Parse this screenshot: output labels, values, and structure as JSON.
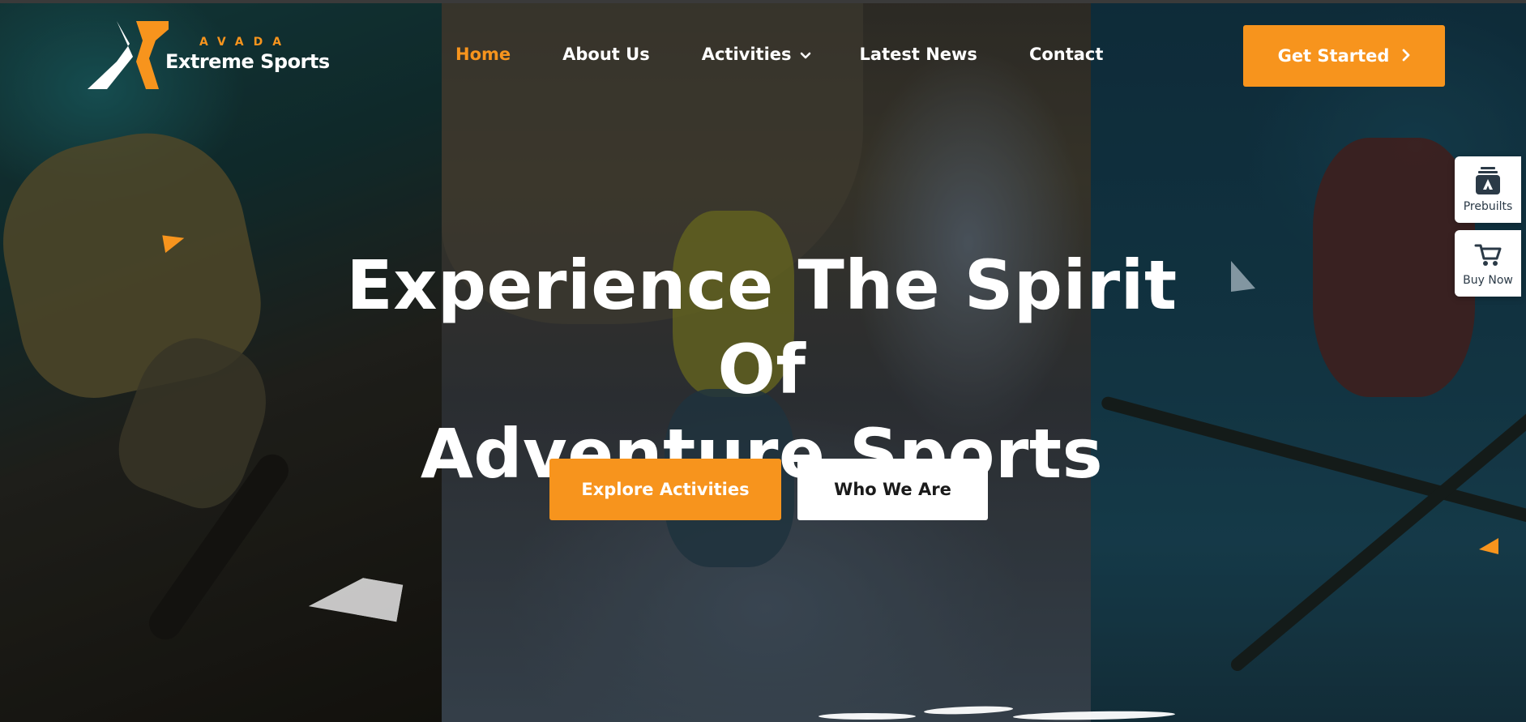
{
  "brand": {
    "top_text": "AVADA",
    "bottom_text": "Extreme Sports",
    "accent_color": "#f7941d"
  },
  "nav": {
    "items": [
      {
        "label": "Home",
        "active": true
      },
      {
        "label": "About Us",
        "active": false
      },
      {
        "label": "Activities",
        "active": false,
        "has_dropdown": true
      },
      {
        "label": "Latest News",
        "active": false
      },
      {
        "label": "Contact",
        "active": false
      }
    ]
  },
  "header": {
    "cta_label": "Get Started"
  },
  "hero": {
    "title_line1": "Experience The Spirit Of",
    "title_line2": "Adventure Sports",
    "primary_button": "Explore Activities",
    "secondary_button": "Who We Are"
  },
  "side_widgets": {
    "prebuilts_label": "Prebuilts",
    "buy_now_label": "Buy Now"
  },
  "icons": {
    "logo": "avada-x-logo",
    "dropdown": "chevron-down-icon",
    "cta_arrow": "chevron-right-icon",
    "prebuilts": "prebuilts-icon",
    "buy_now": "cart-icon"
  }
}
